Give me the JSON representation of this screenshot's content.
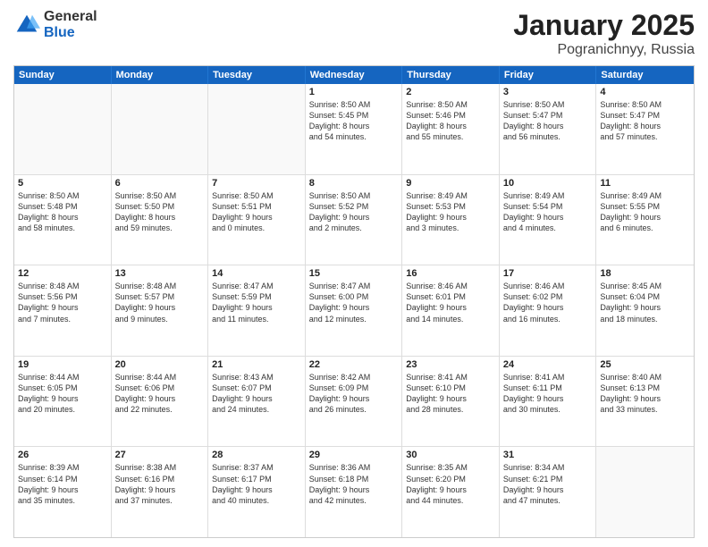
{
  "logo": {
    "general": "General",
    "blue": "Blue"
  },
  "title": "January 2025",
  "subtitle": "Pogranichnyy, Russia",
  "header_days": [
    "Sunday",
    "Monday",
    "Tuesday",
    "Wednesday",
    "Thursday",
    "Friday",
    "Saturday"
  ],
  "rows": [
    [
      {
        "day": "",
        "lines": [],
        "empty": true
      },
      {
        "day": "",
        "lines": [],
        "empty": true
      },
      {
        "day": "",
        "lines": [],
        "empty": true
      },
      {
        "day": "1",
        "lines": [
          "Sunrise: 8:50 AM",
          "Sunset: 5:45 PM",
          "Daylight: 8 hours",
          "and 54 minutes."
        ],
        "empty": false
      },
      {
        "day": "2",
        "lines": [
          "Sunrise: 8:50 AM",
          "Sunset: 5:46 PM",
          "Daylight: 8 hours",
          "and 55 minutes."
        ],
        "empty": false
      },
      {
        "day": "3",
        "lines": [
          "Sunrise: 8:50 AM",
          "Sunset: 5:47 PM",
          "Daylight: 8 hours",
          "and 56 minutes."
        ],
        "empty": false
      },
      {
        "day": "4",
        "lines": [
          "Sunrise: 8:50 AM",
          "Sunset: 5:47 PM",
          "Daylight: 8 hours",
          "and 57 minutes."
        ],
        "empty": false
      }
    ],
    [
      {
        "day": "5",
        "lines": [
          "Sunrise: 8:50 AM",
          "Sunset: 5:48 PM",
          "Daylight: 8 hours",
          "and 58 minutes."
        ],
        "empty": false
      },
      {
        "day": "6",
        "lines": [
          "Sunrise: 8:50 AM",
          "Sunset: 5:50 PM",
          "Daylight: 8 hours",
          "and 59 minutes."
        ],
        "empty": false
      },
      {
        "day": "7",
        "lines": [
          "Sunrise: 8:50 AM",
          "Sunset: 5:51 PM",
          "Daylight: 9 hours",
          "and 0 minutes."
        ],
        "empty": false
      },
      {
        "day": "8",
        "lines": [
          "Sunrise: 8:50 AM",
          "Sunset: 5:52 PM",
          "Daylight: 9 hours",
          "and 2 minutes."
        ],
        "empty": false
      },
      {
        "day": "9",
        "lines": [
          "Sunrise: 8:49 AM",
          "Sunset: 5:53 PM",
          "Daylight: 9 hours",
          "and 3 minutes."
        ],
        "empty": false
      },
      {
        "day": "10",
        "lines": [
          "Sunrise: 8:49 AM",
          "Sunset: 5:54 PM",
          "Daylight: 9 hours",
          "and 4 minutes."
        ],
        "empty": false
      },
      {
        "day": "11",
        "lines": [
          "Sunrise: 8:49 AM",
          "Sunset: 5:55 PM",
          "Daylight: 9 hours",
          "and 6 minutes."
        ],
        "empty": false
      }
    ],
    [
      {
        "day": "12",
        "lines": [
          "Sunrise: 8:48 AM",
          "Sunset: 5:56 PM",
          "Daylight: 9 hours",
          "and 7 minutes."
        ],
        "empty": false
      },
      {
        "day": "13",
        "lines": [
          "Sunrise: 8:48 AM",
          "Sunset: 5:57 PM",
          "Daylight: 9 hours",
          "and 9 minutes."
        ],
        "empty": false
      },
      {
        "day": "14",
        "lines": [
          "Sunrise: 8:47 AM",
          "Sunset: 5:59 PM",
          "Daylight: 9 hours",
          "and 11 minutes."
        ],
        "empty": false
      },
      {
        "day": "15",
        "lines": [
          "Sunrise: 8:47 AM",
          "Sunset: 6:00 PM",
          "Daylight: 9 hours",
          "and 12 minutes."
        ],
        "empty": false
      },
      {
        "day": "16",
        "lines": [
          "Sunrise: 8:46 AM",
          "Sunset: 6:01 PM",
          "Daylight: 9 hours",
          "and 14 minutes."
        ],
        "empty": false
      },
      {
        "day": "17",
        "lines": [
          "Sunrise: 8:46 AM",
          "Sunset: 6:02 PM",
          "Daylight: 9 hours",
          "and 16 minutes."
        ],
        "empty": false
      },
      {
        "day": "18",
        "lines": [
          "Sunrise: 8:45 AM",
          "Sunset: 6:04 PM",
          "Daylight: 9 hours",
          "and 18 minutes."
        ],
        "empty": false
      }
    ],
    [
      {
        "day": "19",
        "lines": [
          "Sunrise: 8:44 AM",
          "Sunset: 6:05 PM",
          "Daylight: 9 hours",
          "and 20 minutes."
        ],
        "empty": false
      },
      {
        "day": "20",
        "lines": [
          "Sunrise: 8:44 AM",
          "Sunset: 6:06 PM",
          "Daylight: 9 hours",
          "and 22 minutes."
        ],
        "empty": false
      },
      {
        "day": "21",
        "lines": [
          "Sunrise: 8:43 AM",
          "Sunset: 6:07 PM",
          "Daylight: 9 hours",
          "and 24 minutes."
        ],
        "empty": false
      },
      {
        "day": "22",
        "lines": [
          "Sunrise: 8:42 AM",
          "Sunset: 6:09 PM",
          "Daylight: 9 hours",
          "and 26 minutes."
        ],
        "empty": false
      },
      {
        "day": "23",
        "lines": [
          "Sunrise: 8:41 AM",
          "Sunset: 6:10 PM",
          "Daylight: 9 hours",
          "and 28 minutes."
        ],
        "empty": false
      },
      {
        "day": "24",
        "lines": [
          "Sunrise: 8:41 AM",
          "Sunset: 6:11 PM",
          "Daylight: 9 hours",
          "and 30 minutes."
        ],
        "empty": false
      },
      {
        "day": "25",
        "lines": [
          "Sunrise: 8:40 AM",
          "Sunset: 6:13 PM",
          "Daylight: 9 hours",
          "and 33 minutes."
        ],
        "empty": false
      }
    ],
    [
      {
        "day": "26",
        "lines": [
          "Sunrise: 8:39 AM",
          "Sunset: 6:14 PM",
          "Daylight: 9 hours",
          "and 35 minutes."
        ],
        "empty": false
      },
      {
        "day": "27",
        "lines": [
          "Sunrise: 8:38 AM",
          "Sunset: 6:16 PM",
          "Daylight: 9 hours",
          "and 37 minutes."
        ],
        "empty": false
      },
      {
        "day": "28",
        "lines": [
          "Sunrise: 8:37 AM",
          "Sunset: 6:17 PM",
          "Daylight: 9 hours",
          "and 40 minutes."
        ],
        "empty": false
      },
      {
        "day": "29",
        "lines": [
          "Sunrise: 8:36 AM",
          "Sunset: 6:18 PM",
          "Daylight: 9 hours",
          "and 42 minutes."
        ],
        "empty": false
      },
      {
        "day": "30",
        "lines": [
          "Sunrise: 8:35 AM",
          "Sunset: 6:20 PM",
          "Daylight: 9 hours",
          "and 44 minutes."
        ],
        "empty": false
      },
      {
        "day": "31",
        "lines": [
          "Sunrise: 8:34 AM",
          "Sunset: 6:21 PM",
          "Daylight: 9 hours",
          "and 47 minutes."
        ],
        "empty": false
      },
      {
        "day": "",
        "lines": [],
        "empty": true
      }
    ]
  ]
}
